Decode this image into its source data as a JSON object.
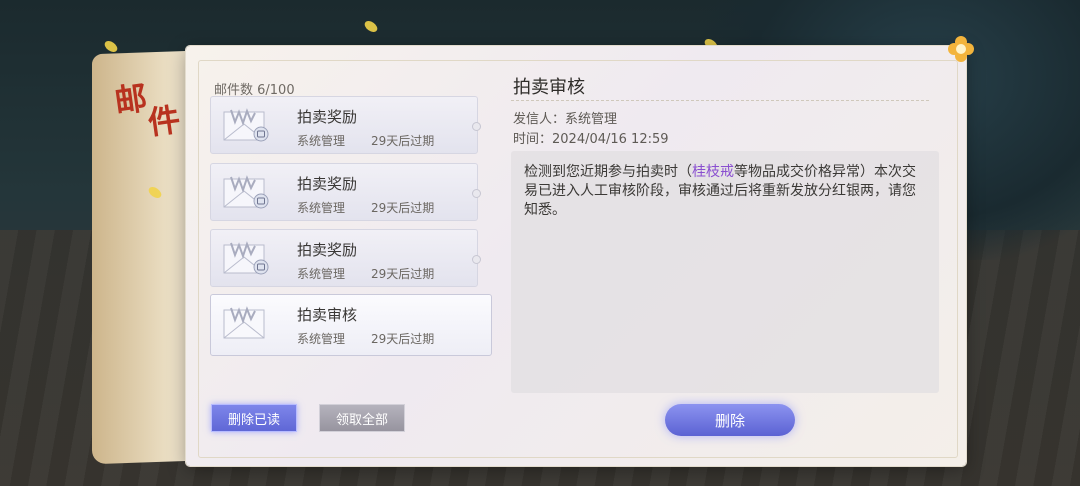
{
  "window": {
    "title_chars": [
      "邮",
      "件"
    ]
  },
  "mail_list": {
    "count_label": "邮件数 6/100",
    "items": [
      {
        "subject": "拍卖奖励",
        "sender": "系统管理",
        "expire": "29天后过期",
        "has_attachment": true,
        "selected": false
      },
      {
        "subject": "拍卖奖励",
        "sender": "系统管理",
        "expire": "29天后过期",
        "has_attachment": true,
        "selected": false
      },
      {
        "subject": "拍卖奖励",
        "sender": "系统管理",
        "expire": "29天后过期",
        "has_attachment": true,
        "selected": false
      },
      {
        "subject": "拍卖审核",
        "sender": "系统管理",
        "expire": "29天后过期",
        "has_attachment": false,
        "selected": true
      }
    ]
  },
  "buttons": {
    "delete_read": "删除已读",
    "claim_all": "领取全部",
    "delete": "删除"
  },
  "detail": {
    "title": "拍卖审核",
    "sender": "发信人：系统管理",
    "time": "时间：2024/04/16 12:59",
    "body_before": "检测到您近期参与拍卖时（",
    "body_highlight": "桂枝戒",
    "body_after": "等物品成交价格异常）本次交易已进入人工审核阶段，审核通过后将重新发放分红银两，请您知悉。"
  },
  "colors": {
    "accent": "#6a72e0",
    "highlight_item": "#8a4fd0",
    "seal_red": "#b8321f",
    "petal": "#f1d34a"
  },
  "icons": {
    "close": "close-flower-icon",
    "envelope": "envelope-icon",
    "attachment": "attachment-badge-icon"
  }
}
